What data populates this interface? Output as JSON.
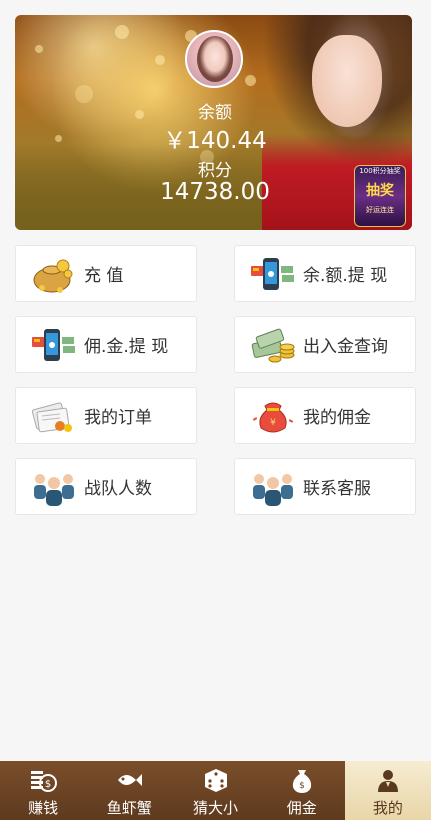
{
  "profile": {
    "balance_label": "余额",
    "balance_value": "￥140.44",
    "points_label": "积分",
    "points_value": "14738.00",
    "promo": {
      "line1": "100积分抽奖",
      "line2": "抽奖",
      "line3": "好运连连"
    }
  },
  "menu": [
    {
      "label": "充 值",
      "icon": "money-bag-icon"
    },
    {
      "label": "余.额.提 现",
      "icon": "phone-cash-icon"
    },
    {
      "label": "佣.金.提 现",
      "icon": "phone-cash-icon"
    },
    {
      "label": "出入金查询",
      "icon": "cash-coins-icon"
    },
    {
      "label": "我的订单",
      "icon": "orders-icon"
    },
    {
      "label": "我的佣金",
      "icon": "red-pouch-icon"
    },
    {
      "label": "战队人数",
      "icon": "team-icon"
    },
    {
      "label": "联系客服",
      "icon": "team-icon"
    }
  ],
  "tabbar": {
    "items": [
      {
        "label": "赚钱",
        "icon": "coin-stack-icon"
      },
      {
        "label": "鱼虾蟹",
        "icon": "fish-icon"
      },
      {
        "label": "猜大小",
        "icon": "dice-icon"
      },
      {
        "label": "佣金",
        "icon": "money-sack-icon"
      },
      {
        "label": "我的",
        "icon": "user-icon"
      }
    ],
    "active": "我的"
  },
  "colors": {
    "tabbar": "#6b4424",
    "tab_active": "#efe0b8",
    "text": "#333333"
  }
}
